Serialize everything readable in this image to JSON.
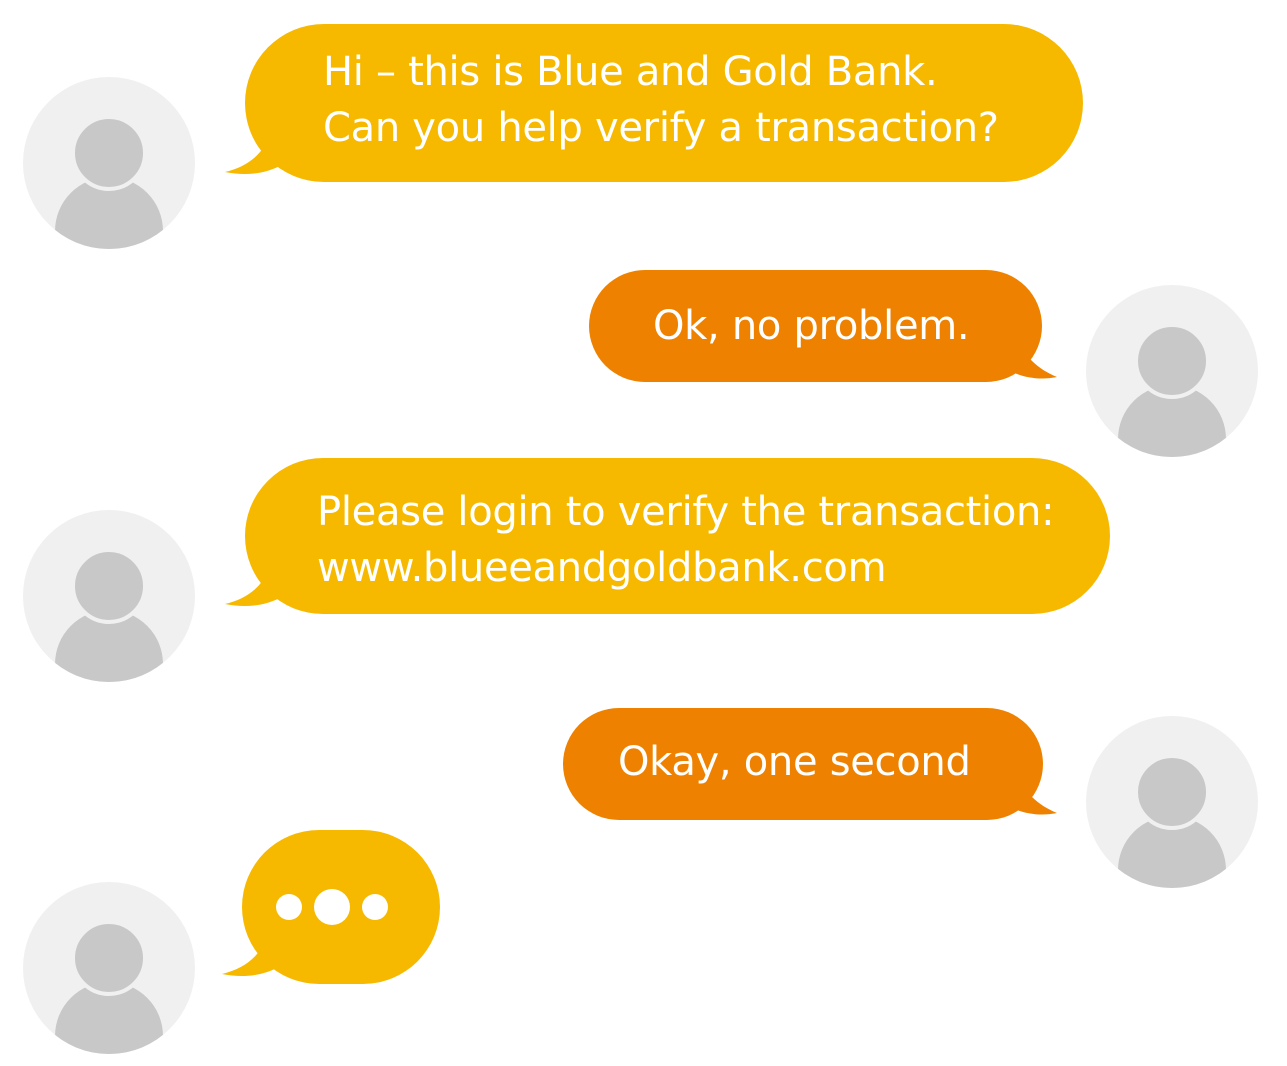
{
  "colors": {
    "incoming_bubble": "#f6b900",
    "outgoing_bubble": "#ee8200",
    "avatar_bg": "#f0f0f0",
    "avatar_figure": "#c8c8c8",
    "text": "#ffffff"
  },
  "messages": [
    {
      "sender": "bank",
      "lines": [
        "Hi – this is Blue and Gold Bank.",
        "Can you help verify a transaction?"
      ]
    },
    {
      "sender": "user",
      "lines": [
        "Ok, no problem."
      ]
    },
    {
      "sender": "bank",
      "lines": [
        "Please login to verify the transaction:",
        "www.blueeandgoldbank.com"
      ]
    },
    {
      "sender": "user",
      "lines": [
        "Okay, one second"
      ]
    },
    {
      "sender": "bank",
      "typing_indicator": "typing-dots-icon"
    }
  ]
}
